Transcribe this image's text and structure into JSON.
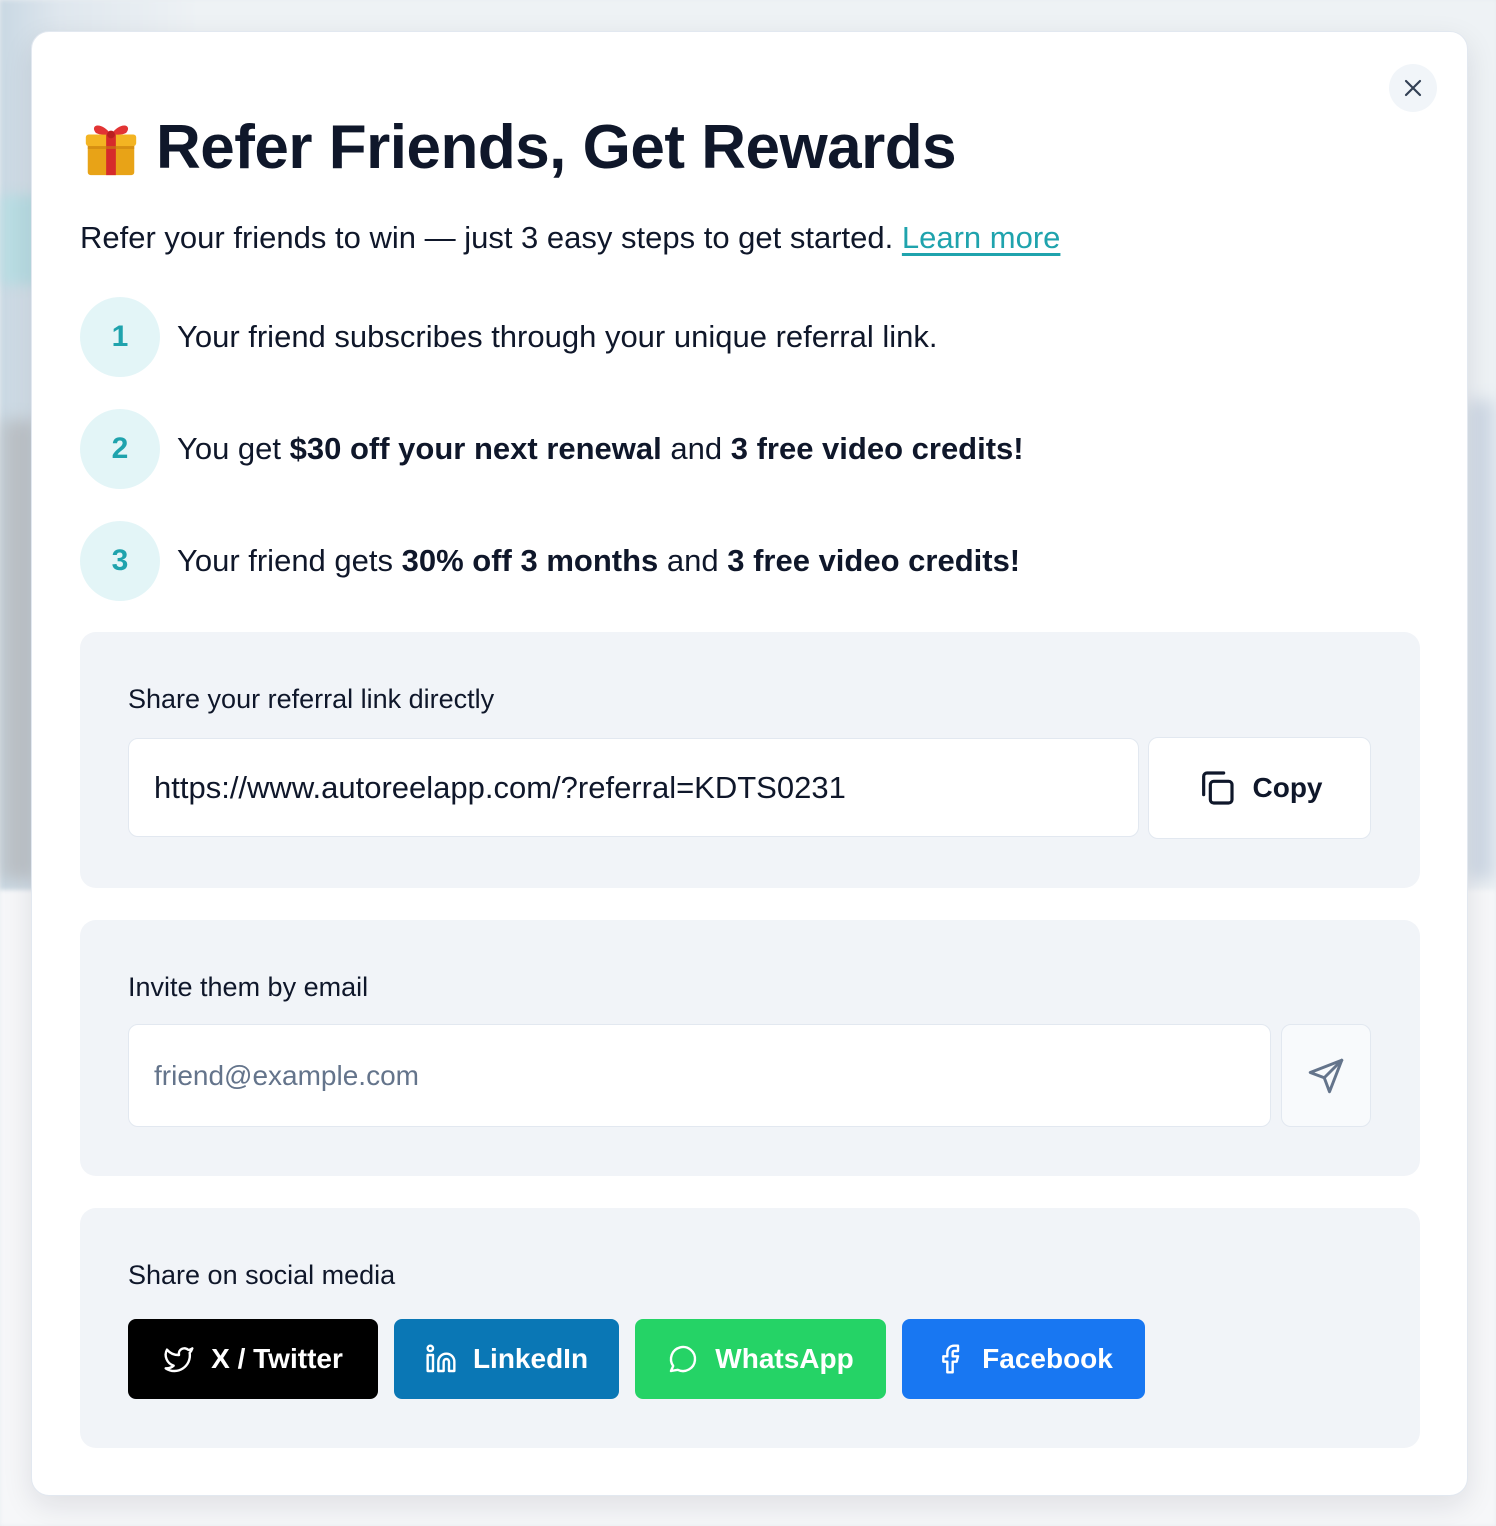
{
  "dialog": {
    "title": "Refer Friends, Get Rewards",
    "intro": "Refer your friends to win — just 3 easy steps to get started.",
    "learn_more": "Learn more",
    "close_icon": "close-icon",
    "gift_icon": "gift-emoji-icon"
  },
  "steps": [
    {
      "number": "1",
      "parts": [
        {
          "text": "Your friend subscribes through your unique referral link.",
          "bold": false
        }
      ]
    },
    {
      "number": "2",
      "parts": [
        {
          "text": "You get ",
          "bold": false
        },
        {
          "text": "$30 off your next renewal",
          "bold": true
        },
        {
          "text": " and ",
          "bold": false
        },
        {
          "text": "3 free video credits!",
          "bold": true
        }
      ]
    },
    {
      "number": "3",
      "parts": [
        {
          "text": "Your friend gets ",
          "bold": false
        },
        {
          "text": "30% off 3 months",
          "bold": true
        },
        {
          "text": " and ",
          "bold": false
        },
        {
          "text": "3 free video credits!",
          "bold": true
        }
      ]
    }
  ],
  "share_link": {
    "label": "Share your referral link directly",
    "url": "https://www.autoreelapp.com/?referral=KDTS0231",
    "copy_label": "Copy",
    "copy_icon": "copy-icon"
  },
  "email_invite": {
    "label": "Invite them by email",
    "value": "",
    "placeholder": "friend@example.com",
    "send_icon": "send-icon"
  },
  "social": {
    "label": "Share on social media",
    "buttons": [
      {
        "label": "X / Twitter",
        "icon": "twitter-icon",
        "color": "#000000"
      },
      {
        "label": "LinkedIn",
        "icon": "linkedin-icon",
        "color": "#0a77b5"
      },
      {
        "label": "WhatsApp",
        "icon": "whatsapp-icon",
        "color": "#25d366"
      },
      {
        "label": "Facebook",
        "icon": "facebook-icon",
        "color": "#1877f2"
      }
    ]
  },
  "colors": {
    "accent": "#1fa3ad",
    "step_circle_bg": "#e3f5f7",
    "panel_bg": "#f1f4f8"
  }
}
